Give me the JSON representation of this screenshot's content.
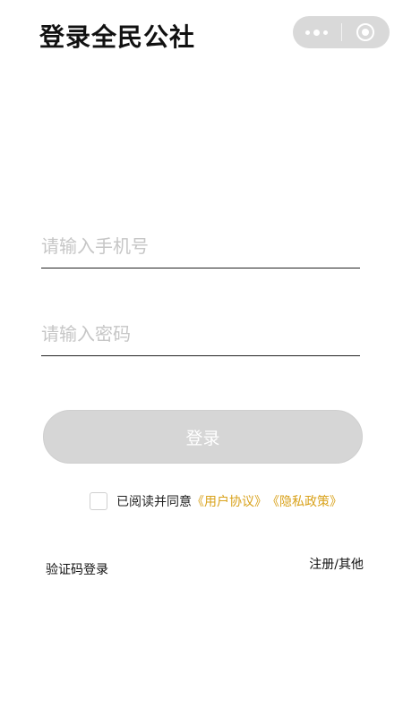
{
  "header": {
    "title": "登录全民公社",
    "capsule_icons": [
      "more-icon",
      "close-icon"
    ]
  },
  "form": {
    "phone_placeholder": "请输入手机号",
    "phone_value": "",
    "password_placeholder": "请输入密码",
    "password_value": "",
    "login_label": "登录"
  },
  "agreement": {
    "prefix": "已阅读并同意",
    "user_agreement": "《用户协议》",
    "privacy_policy": "《隐私政策》",
    "checked": false,
    "link_color": "#d9a21b"
  },
  "footer": {
    "sms_login": "验证码登录",
    "register_other": "注册/其他"
  },
  "colors": {
    "button_bg": "#d6d6d6",
    "placeholder": "#c6c6c6",
    "capsule_bg": "#d9d9d9"
  }
}
